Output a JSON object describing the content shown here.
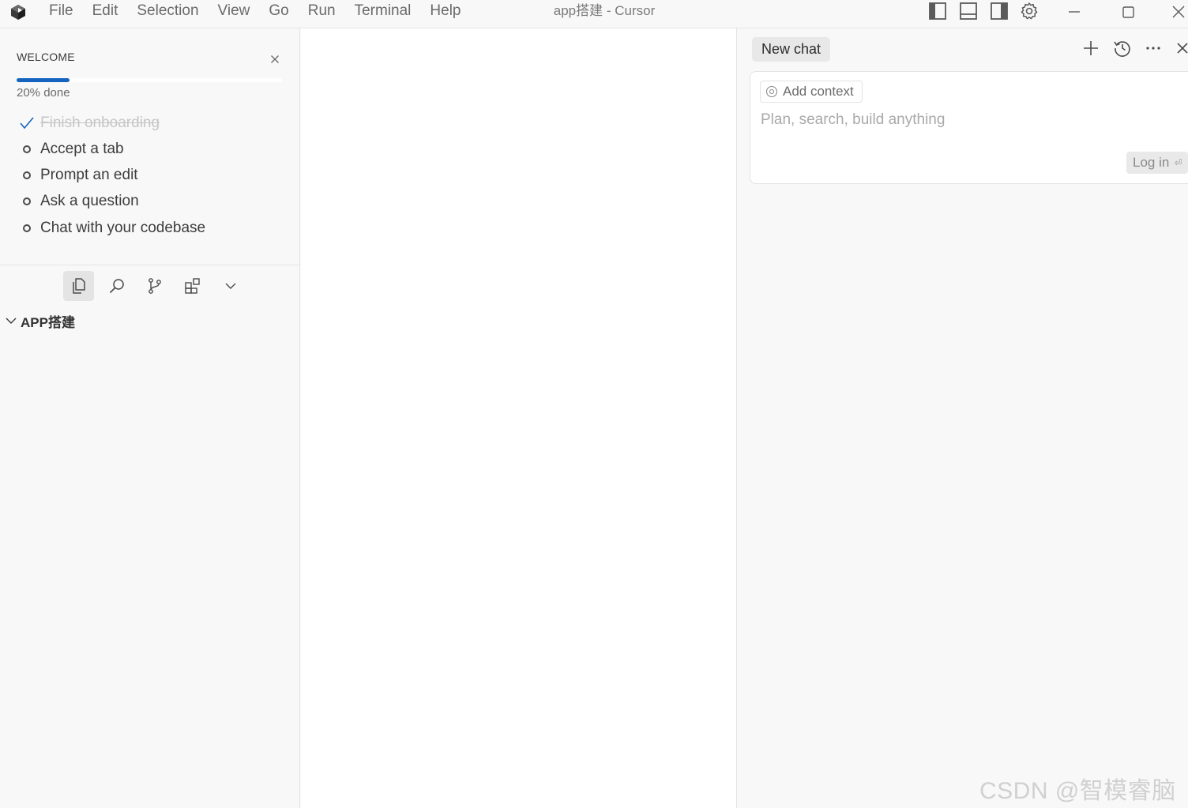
{
  "titlebar": {
    "menu": [
      "File",
      "Edit",
      "Selection",
      "View",
      "Go",
      "Run",
      "Terminal",
      "Help"
    ],
    "title": "app搭建 - Cursor",
    "icons": [
      "toggle-primary-sidebar-icon",
      "toggle-panel-icon",
      "toggle-secondary-sidebar-icon",
      "settings-gear-icon"
    ],
    "window_controls": [
      "minimize-icon",
      "maximize-icon",
      "close-icon"
    ]
  },
  "welcome": {
    "title": "WELCOME",
    "progress_text": "20% done",
    "progress": 0.2,
    "tasks": [
      {
        "label": "Finish onboarding",
        "done": true
      },
      {
        "label": "Accept a tab",
        "done": false
      },
      {
        "label": "Prompt an edit",
        "done": false
      },
      {
        "label": "Ask a question",
        "done": false
      },
      {
        "label": "Chat with your codebase",
        "done": false
      }
    ]
  },
  "activity_bar": [
    "explorer-icon",
    "search-icon",
    "source-control-icon",
    "extensions-icon",
    "chevron-down-icon"
  ],
  "explorer": {
    "folder": "APP搭建"
  },
  "chat": {
    "tab": "New chat",
    "actions": [
      "plus-icon",
      "history-icon",
      "more-icon",
      "close-icon"
    ],
    "add_context": "Add context",
    "placeholder": "Plan, search, build anything",
    "login": "Log in"
  },
  "watermark": "CSDN @智模睿脑君",
  "colors": {
    "accent": "#1664c0",
    "background": "#f8f8f8",
    "editor": "#ffffff"
  }
}
